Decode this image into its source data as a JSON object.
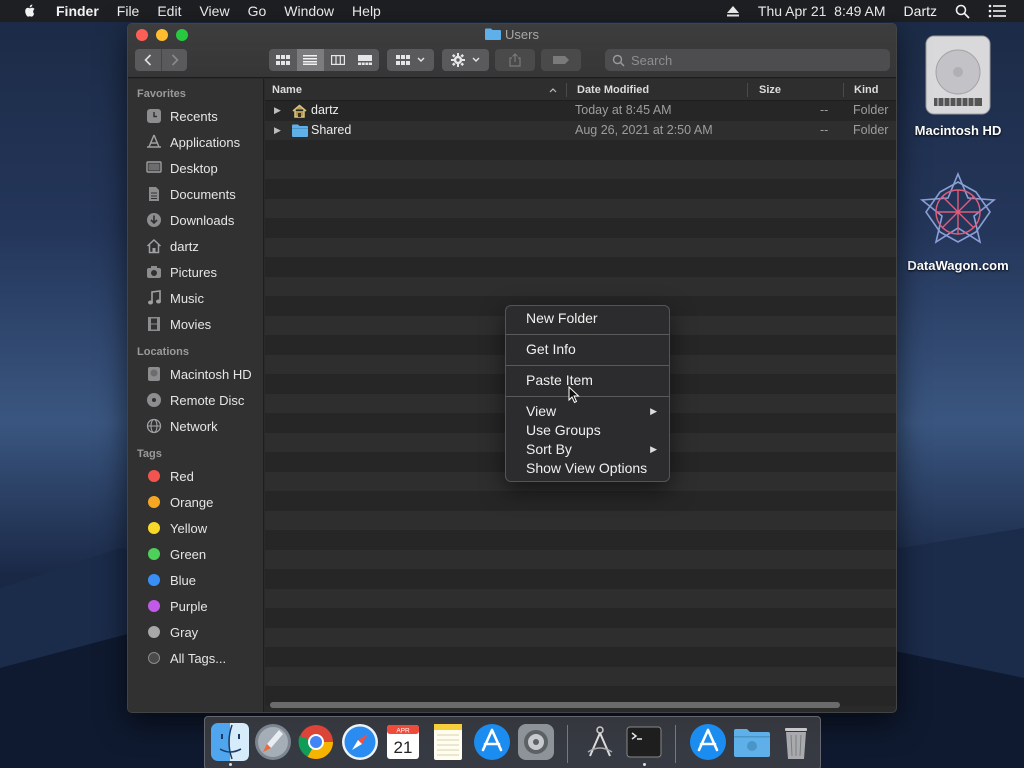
{
  "menubar": {
    "app": "Finder",
    "items": [
      "File",
      "Edit",
      "View",
      "Go",
      "Window",
      "Help"
    ],
    "datetime": "Thu Apr 21  8:49 AM",
    "user": "Dartz"
  },
  "window": {
    "title": "Users",
    "search_placeholder": "Search"
  },
  "sidebar": {
    "favorites_heading": "Favorites",
    "favorites": [
      {
        "label": "Recents",
        "icon": "clock-icon"
      },
      {
        "label": "Applications",
        "icon": "applications-icon"
      },
      {
        "label": "Desktop",
        "icon": "desktop-icon"
      },
      {
        "label": "Documents",
        "icon": "document-icon"
      },
      {
        "label": "Downloads",
        "icon": "download-icon"
      },
      {
        "label": "dartz",
        "icon": "home-icon"
      },
      {
        "label": "Pictures",
        "icon": "camera-icon"
      },
      {
        "label": "Music",
        "icon": "music-note-icon"
      },
      {
        "label": "Movies",
        "icon": "film-icon"
      }
    ],
    "locations_heading": "Locations",
    "locations": [
      {
        "label": "Macintosh HD",
        "icon": "hard-drive-icon"
      },
      {
        "label": "Remote Disc",
        "icon": "disc-icon"
      },
      {
        "label": "Network",
        "icon": "globe-icon"
      }
    ],
    "tags_heading": "Tags",
    "tags": [
      {
        "label": "Red",
        "color": "#f2544f"
      },
      {
        "label": "Orange",
        "color": "#f5a623"
      },
      {
        "label": "Yellow",
        "color": "#f8d92a"
      },
      {
        "label": "Green",
        "color": "#4ed05a"
      },
      {
        "label": "Blue",
        "color": "#3a8ff7"
      },
      {
        "label": "Purple",
        "color": "#c25ae8"
      },
      {
        "label": "Gray",
        "color": "#a8a8a8"
      }
    ],
    "all_tags": "All Tags..."
  },
  "columns": {
    "name": "Name",
    "date_modified": "Date Modified",
    "size": "Size",
    "kind": "Kind"
  },
  "files": [
    {
      "name": "dartz",
      "date": "Today at 8:45 AM",
      "size": "--",
      "kind": "Folder",
      "icon": "home-folder-icon"
    },
    {
      "name": "Shared",
      "date": "Aug 26, 2021 at 2:50 AM",
      "size": "--",
      "kind": "Folder",
      "icon": "folder-icon"
    }
  ],
  "context_menu": {
    "new_folder": "New Folder",
    "get_info": "Get Info",
    "paste_item": "Paste Item",
    "view": "View",
    "use_groups": "Use Groups",
    "sort_by": "Sort By",
    "show_view_options": "Show View Options"
  },
  "desktop": {
    "icons": [
      {
        "label": "Macintosh HD",
        "icon": "hard-drive-icon"
      },
      {
        "label": "DataWagon.com",
        "icon": "datawagon-icon"
      }
    ]
  },
  "dock": {
    "apps": [
      "Finder",
      "Launchpad",
      "Google Chrome",
      "Safari",
      "Calendar",
      "Notes",
      "App Store",
      "System Preferences",
      "Screenshot",
      "Terminal",
      "Applications",
      "Downloads",
      "Trash"
    ],
    "calendar_month": "APR",
    "calendar_day": "21"
  },
  "colors": {
    "accent_blue": "#3a8ff7",
    "window_bg": "#2a2a2b",
    "sidebar_bg": "#313132"
  }
}
